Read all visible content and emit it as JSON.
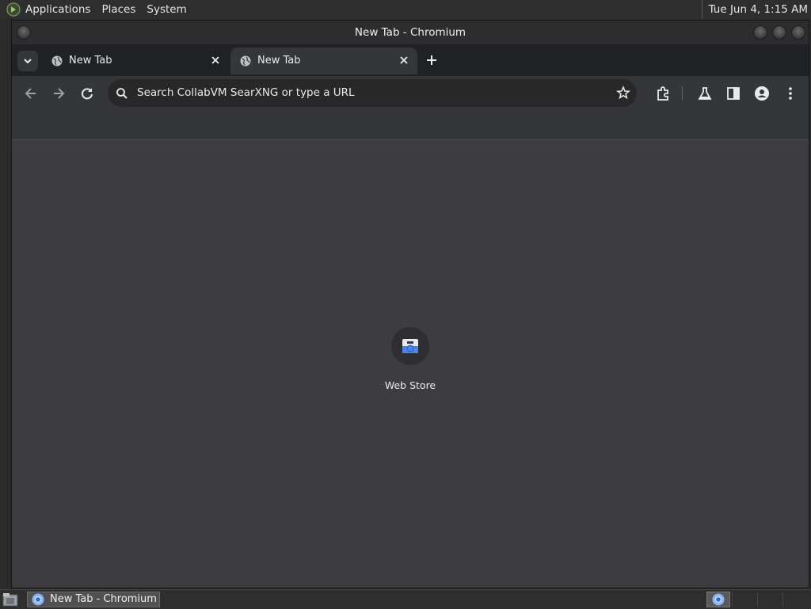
{
  "top_panel": {
    "menus": [
      "Applications",
      "Places",
      "System"
    ],
    "clock": "Tue Jun  4,  1:15 AM"
  },
  "window": {
    "title": "New Tab - Chromium",
    "tabs": [
      {
        "label": "New Tab",
        "active": false
      },
      {
        "label": "New Tab",
        "active": true
      }
    ]
  },
  "toolbar": {
    "omnibox_placeholder": "Search CollabVM SearXNG or type a URL"
  },
  "content": {
    "shortcuts": [
      {
        "label": "Web Store"
      }
    ]
  },
  "bottom_panel": {
    "task": {
      "label": "New Tab - Chromium"
    }
  },
  "colors": {
    "accent": "#8ab4f8",
    "content_bg": "#3c3c41",
    "toolbar_bg": "#35363a"
  },
  "icons": [
    "menu-logo-icon",
    "tab-search-icon",
    "globe-icon",
    "close-icon",
    "plus-icon",
    "back-icon",
    "forward-icon",
    "reload-icon",
    "search-icon",
    "star-icon",
    "extensions-icon",
    "labs-icon",
    "side-panel-icon",
    "profile-icon",
    "more-icon",
    "web-store-icon",
    "chromium-icon",
    "file-manager-icon"
  ]
}
